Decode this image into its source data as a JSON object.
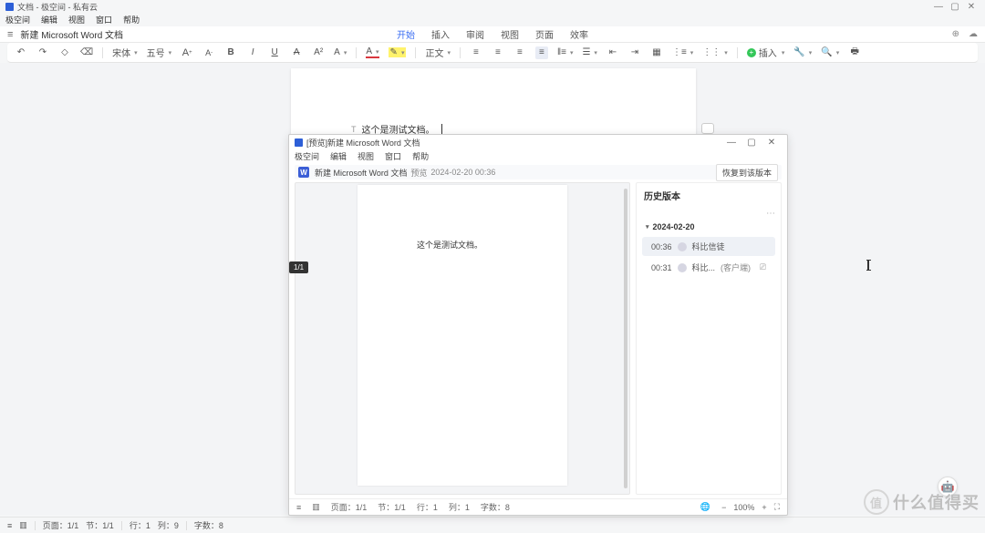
{
  "window": {
    "title": "文档 - 极空间 - 私有云",
    "controls": {
      "min": "—",
      "max": "▢",
      "close": "✕"
    }
  },
  "menubar": [
    "极空间",
    "编辑",
    "视图",
    "窗口",
    "帮助"
  ],
  "doc_title": "新建 Microsoft Word 文档",
  "tabs": [
    {
      "label": "开始",
      "active": true
    },
    {
      "label": "插入",
      "active": false
    },
    {
      "label": "审阅",
      "active": false
    },
    {
      "label": "视图",
      "active": false
    },
    {
      "label": "页面",
      "active": false
    },
    {
      "label": "效率",
      "active": false
    }
  ],
  "toolbar": {
    "font_family": "宋体",
    "font_size": "五号",
    "para_style": "正文",
    "insert_label": "插入",
    "highlight_color": "#fff36b",
    "font_color": "#d9363e"
  },
  "document": {
    "body_text": "这个是测试文档。"
  },
  "statusbar": {
    "page": "页面：1/1",
    "section": "节：1/1",
    "line": "行：1",
    "col": "列：9",
    "words": "字数：8"
  },
  "preview": {
    "title": "[预览]新建 Microsoft Word 文档",
    "menubar": [
      "极空间",
      "编辑",
      "视图",
      "窗口",
      "帮助"
    ],
    "doc_name": "新建 Microsoft Word 文档",
    "meta_label": "预览",
    "meta_time": "2024-02-20 00:36",
    "restore_btn": "恢复到该版本",
    "body_text": "这个是测试文档。",
    "page_badge": "1/1",
    "history": {
      "title": "历史版本",
      "groups": [
        {
          "date": "2024-02-20",
          "versions": [
            {
              "time": "00:36",
              "user": "科比信徒",
              "client": "",
              "active": true
            },
            {
              "time": "00:31",
              "user": "科比...",
              "client": "(客户端)",
              "active": false
            }
          ]
        }
      ]
    },
    "status": {
      "page": "页面：1/1",
      "section": "节：1/1",
      "line": "行：1",
      "col": "列：1",
      "words": "字数：8",
      "zoom": "100%"
    }
  },
  "watermark": "什么值得买"
}
